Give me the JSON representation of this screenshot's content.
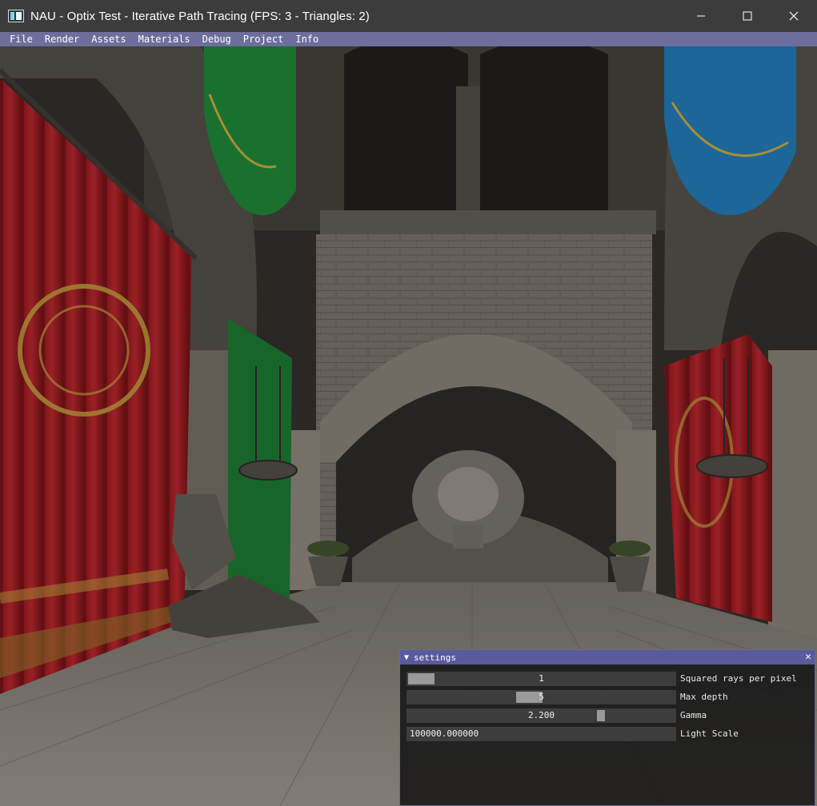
{
  "window": {
    "title": "NAU - Optix Test - Iterative Path Tracing (FPS: 3 - Triangles: 2)",
    "icon": "app-icon",
    "buttons": [
      "minimize-icon",
      "maximize-icon",
      "close-icon"
    ]
  },
  "menu": {
    "items": [
      "File",
      "Render",
      "Assets",
      "Materials",
      "Debug",
      "Project",
      "Info"
    ]
  },
  "settings": {
    "title": "settings",
    "collapse_glyph": "▼",
    "close_glyph": "✕",
    "rows": [
      {
        "label": "Squared rays per pixel",
        "value": "1",
        "kind": "slider",
        "fraction": 0.0
      },
      {
        "label": "Max depth",
        "value": "5",
        "kind": "slider",
        "fraction": 0.45
      },
      {
        "label": "Gamma",
        "value": "2.200",
        "kind": "slider",
        "fraction": 0.73
      },
      {
        "label": "Light Scale",
        "value": "100000.000000",
        "kind": "input"
      }
    ]
  },
  "colors": {
    "menubar": "#6e6e9c",
    "settings_title": "#5a5a9e",
    "curtain_red": "#9e1f24",
    "banner_green": "#1d7a34",
    "banner_blue": "#1f6fa6",
    "stone": "#8a847a"
  }
}
